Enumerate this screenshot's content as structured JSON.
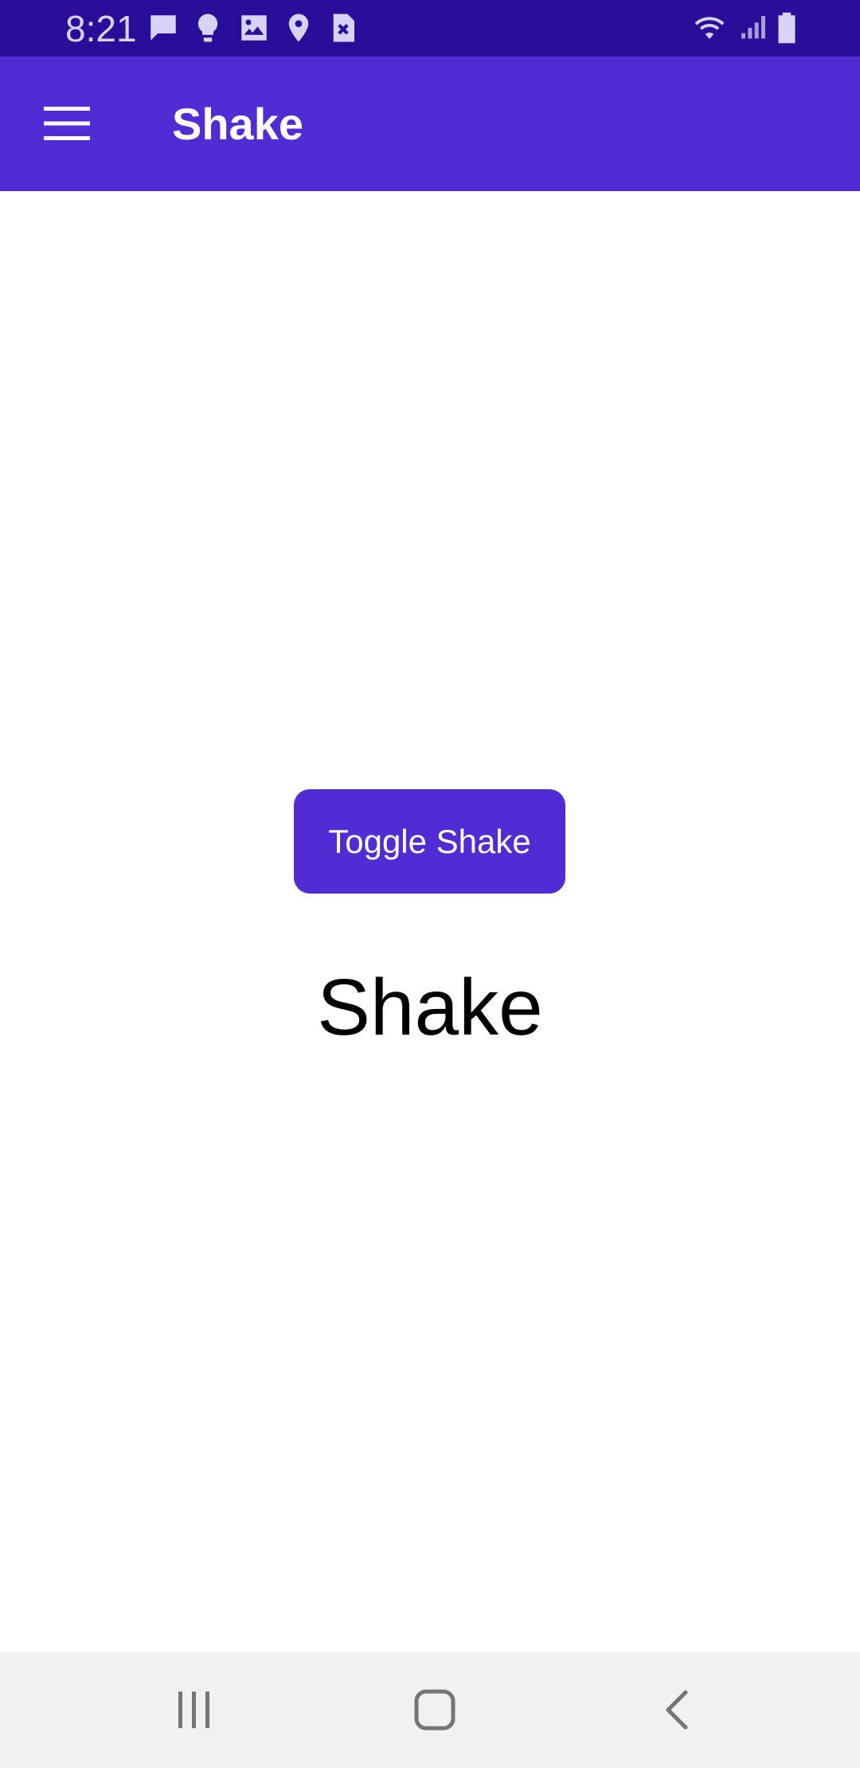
{
  "status_bar": {
    "time": "8:21",
    "background": "#2a0d99",
    "notification_icons": [
      "message-icon",
      "lightbulb-icon",
      "image-icon",
      "location-pin-icon",
      "close-box-icon"
    ],
    "system_icons": [
      "wifi-icon",
      "signal-icon",
      "battery-icon"
    ]
  },
  "app_bar": {
    "title": "Shake",
    "menu_icon": "hamburger-menu-icon",
    "background": "#512bd4"
  },
  "main": {
    "toggle_button_label": "Toggle Shake",
    "shake_label": "Shake",
    "accent": "#512bd4"
  },
  "nav_bar": {
    "buttons": [
      "recent-apps-icon",
      "home-icon",
      "back-icon"
    ]
  }
}
